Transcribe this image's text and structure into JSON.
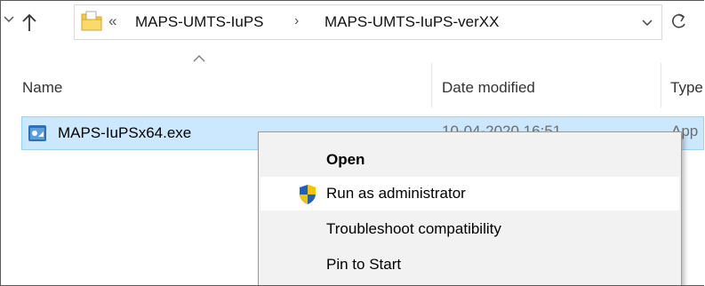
{
  "address_bar": {
    "overflow_marker": "«",
    "crumbs": [
      "MAPS-UMTS-IuPS",
      "MAPS-UMTS-IuPS-verXX"
    ],
    "separator": "›"
  },
  "columns": {
    "name": "Name",
    "date_modified": "Date modified",
    "type": "Type"
  },
  "files": [
    {
      "name": "MAPS-IuPSx64.exe",
      "date_modified": "10-04-2020 16:51",
      "type": "App",
      "selected": true
    }
  ],
  "context_menu": {
    "items": [
      {
        "label": "Open",
        "bold": true
      },
      {
        "label": "Run as administrator",
        "icon": "uac-shield-icon",
        "hovered": true
      },
      {
        "label": "Troubleshoot compatibility"
      },
      {
        "label": "Pin to Start"
      }
    ]
  },
  "colors": {
    "selection_bg": "#cce8ff",
    "selection_border": "#99d1ff",
    "menu_bg": "#f2f2f2",
    "menu_hover": "#ffffff"
  }
}
